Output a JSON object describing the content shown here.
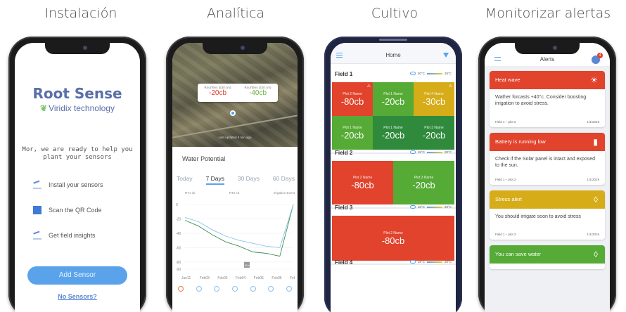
{
  "captions": {
    "install": "Instalación",
    "analytics": "Analítica",
    "crop": "Cultivo",
    "alerts": "Monitorizar alertas"
  },
  "install_screen": {
    "brand": "Root Sense",
    "subtitle": "Viridix technology",
    "intro_line1": "Mor, we are ready to help you",
    "intro_line2": "plant your sensors",
    "steps": [
      "Install your sensors",
      "Scan the QR Code",
      "Get field insights"
    ],
    "button": "Add Sensor",
    "link": "No Sensors?"
  },
  "analytics_screen": {
    "popup_left_label": "RootTens 3(30 cm)",
    "popup_left_value": "-20cb",
    "popup_right_label": "RootTens 2(20 cm)",
    "popup_right_value": "-40cb",
    "map_updated": "Last updated 5 min ago",
    "section_title": "Water Potential",
    "tabs": [
      "Today",
      "7 Days",
      "30 Days",
      "60 Days"
    ],
    "active_tab": "7 Days",
    "legend": [
      "RT1 cb",
      "RT2 cb",
      "Irrigation Event"
    ]
  },
  "crop_screen": {
    "title": "Home",
    "fields": [
      {
        "name": "Field 1",
        "temp_low": "30°C",
        "temp_high": "20°C",
        "plots": [
          {
            "name": "Plot 2 Name",
            "value": "-80cb",
            "color": "#e1432c"
          },
          {
            "name": "Plot 1 Name",
            "value": "-20cb",
            "color": "#55ab35"
          },
          {
            "name": "Plot 4 Name",
            "value": "-30cb",
            "color": "#d6ac19"
          },
          {
            "name": "Plot 1 Name",
            "value": "-20cb",
            "color": "#55ab35"
          },
          {
            "name": "Plot 1 Name",
            "value": "-20cb",
            "color": "#2f8a3c"
          },
          {
            "name": "Plot 3 Name",
            "value": "-20cb",
            "color": "#2f8a3c"
          }
        ]
      },
      {
        "name": "Field 2",
        "temp_low": "15°C",
        "temp_high": "20°C",
        "plots": [
          {
            "name": "Plot 2 Name",
            "value": "-80cb",
            "color": "#e1432c"
          },
          {
            "name": "Plot 3 Name",
            "value": "-20cb",
            "color": "#55ab35"
          }
        ]
      },
      {
        "name": "Field 3",
        "temp_low": "18°C",
        "temp_high": "20°C",
        "plots": [
          {
            "name": "Plot 2 Name",
            "value": "-80cb",
            "color": "#e1432c"
          }
        ]
      },
      {
        "name": "Field 4",
        "temp_low": "15°C",
        "temp_high": "20°C",
        "plots": []
      }
    ]
  },
  "alerts_screen": {
    "title": "Alerts",
    "badge": "4",
    "alerts": [
      {
        "title": "Heat wave",
        "icon": "sun-icon",
        "color": "#e1432c",
        "body": "Wather forcasts +40°c. Consider boosting irrigation to avoid stress.",
        "location": "Field 4 – plot 2",
        "date": "1/1/2019"
      },
      {
        "title": "Battery is running low",
        "icon": "battery-icon",
        "color": "#e1432c",
        "body": "Check if the Solar panel is intact and exposed to the sun.",
        "location": "Field 1 – plot 2",
        "date": "1/1/2019"
      },
      {
        "title": "Stress alert",
        "icon": "drop-icon",
        "color": "#d6ac19",
        "body": "You should irrigate soon to avoid stress",
        "location": "Field 1 – plot 2",
        "date": "1/1/2019"
      },
      {
        "title": "You can save water",
        "icon": "drop-icon",
        "color": "#55ab35",
        "body": "",
        "location": "",
        "date": ""
      }
    ]
  },
  "chart_data": {
    "type": "line",
    "title": "Water Potential",
    "x": [
      "Jun11",
      "Feb03",
      "Feb03",
      "Feb04",
      "Feb05",
      "Feb06",
      "Feb07"
    ],
    "y_ticks": [
      0,
      -20,
      -40,
      -60,
      -80,
      -90
    ],
    "series": [
      {
        "name": "RT1 cb",
        "values": [
          -22,
          -30,
          -42,
          -52,
          -58,
          -66,
          -68,
          -72,
          0
        ]
      },
      {
        "name": "RT2 cb",
        "values": [
          -18,
          -24,
          -35,
          -44,
          -50,
          -54,
          -58,
          -60,
          0
        ]
      }
    ],
    "annotations": [
      "80 cb"
    ]
  }
}
